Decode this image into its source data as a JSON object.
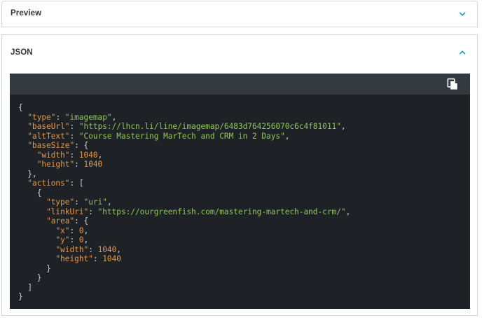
{
  "preview": {
    "title": "Preview",
    "expanded": false,
    "chevron_icon": "chevron-down-icon"
  },
  "json_panel": {
    "title": "JSON",
    "expanded": true,
    "chevron_icon": "chevron-up-icon",
    "copy_icon": "copy-icon",
    "code": {
      "type": "imagemap",
      "baseUrl": "https://lhcn.li/line/imagemap/6483d764256070c6c4f81011",
      "altText": "Course Mastering MarTech and CRM in 2 Days",
      "baseSize": {
        "width": "1040",
        "height": "1040"
      },
      "actions": [
        {
          "type": "uri",
          "linkUri": "https://ourgreenfish.com/mastering-martech-and-crm/",
          "area": {
            "x": "0",
            "y": "0",
            "width": "1040",
            "height": "1040"
          }
        }
      ]
    }
  },
  "colors": {
    "accent": "#1a9bd7",
    "code_bg": "#1e2226",
    "code_toolbar": "#34393e",
    "json_key": "#e49849",
    "json_string": "#8ec45a",
    "json_number": "#e49849"
  }
}
